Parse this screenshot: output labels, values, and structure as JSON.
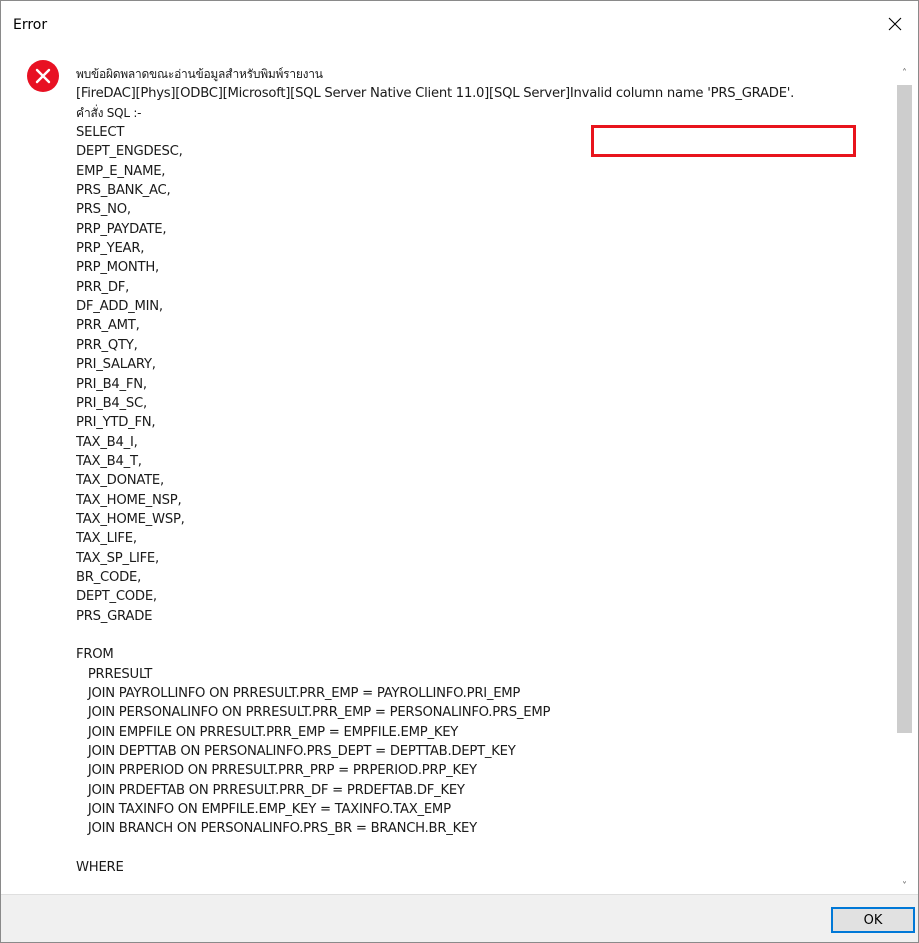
{
  "window": {
    "title": "Error",
    "close_glyph": "✕",
    "icon": "error-icon",
    "accent": "#e81123"
  },
  "message": {
    "lines": [
      "พบข้อผิดพลาดขณะอ่านข้อมูลสำหรับพิมพ์รายงาน",
      "[FireDAC][Phys][ODBC][Microsoft][SQL Server Native Client 11.0][SQL Server]Invalid column name 'PRS_GRADE'.",
      "คำสั่ง SQL :-",
      "SELECT",
      "DEPT_ENGDESC,",
      "EMP_E_NAME,",
      "PRS_BANK_AC,",
      "PRS_NO,",
      "PRP_PAYDATE,",
      "PRP_YEAR,",
      "PRP_MONTH,",
      "PRR_DF,",
      "DF_ADD_MIN,",
      "PRR_AMT,",
      "PRR_QTY,",
      "PRI_SALARY,",
      "PRI_B4_FN,",
      "PRI_B4_SC,",
      "PRI_YTD_FN,",
      "TAX_B4_I,",
      "TAX_B4_T,",
      "TAX_DONATE,",
      "TAX_HOME_NSP,",
      "TAX_HOME_WSP,",
      "TAX_LIFE,",
      "TAX_SP_LIFE,",
      "BR_CODE,",
      "DEPT_CODE,",
      "PRS_GRADE",
      "",
      "FROM",
      "   PRRESULT",
      "   JOIN PAYROLLINFO ON PRRESULT.PRR_EMP = PAYROLLINFO.PRI_EMP",
      "   JOIN PERSONALINFO ON PRRESULT.PRR_EMP = PERSONALINFO.PRS_EMP",
      "   JOIN EMPFILE ON PRRESULT.PRR_EMP = EMPFILE.EMP_KEY",
      "   JOIN DEPTTAB ON PERSONALINFO.PRS_DEPT = DEPTTAB.DEPT_KEY",
      "   JOIN PRPERIOD ON PRRESULT.PRR_PRP = PRPERIOD.PRP_KEY",
      "   JOIN PRDEFTAB ON PRRESULT.PRR_DF = PRDEFTAB.DF_KEY",
      "   JOIN TAXINFO ON EMPFILE.EMP_KEY = TAXINFO.TAX_EMP",
      "   JOIN BRANCH ON PERSONALINFO.PRS_BR = BRANCH.BR_KEY",
      "",
      "WHERE"
    ],
    "highlight_color": "#e8141c"
  },
  "scrollbar": {
    "up_glyph": "˄",
    "down_glyph": "˅"
  },
  "footer": {
    "ok_label": "OK"
  }
}
